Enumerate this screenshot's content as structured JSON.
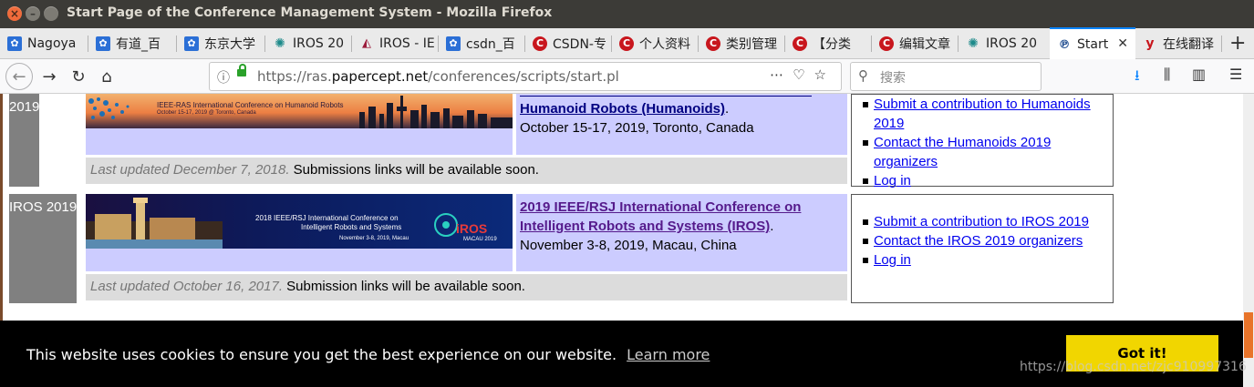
{
  "window": {
    "title": "Start Page of the Conference Management System - Mozilla Firefox"
  },
  "tabs": [
    {
      "label": "Nagoya",
      "icon": "paw-icon"
    },
    {
      "label": "有道_百",
      "icon": "paw-icon"
    },
    {
      "label": "东京大学",
      "icon": "paw-icon"
    },
    {
      "label": "IROS 20",
      "icon": "ieee-icon"
    },
    {
      "label": "IROS - IE",
      "icon": "ieee-icon"
    },
    {
      "label": "csdn_百",
      "icon": "paw-icon"
    },
    {
      "label": "CSDN-专",
      "icon": "csdn-icon"
    },
    {
      "label": "个人资料",
      "icon": "csdn-icon"
    },
    {
      "label": "类别管理",
      "icon": "csdn-icon"
    },
    {
      "label": "【分类",
      "icon": "csdn-icon"
    },
    {
      "label": "编辑文章",
      "icon": "csdn-icon"
    },
    {
      "label": "IROS 20",
      "icon": "ieee-icon"
    },
    {
      "label": "Start",
      "icon": "papercept-icon",
      "active": true
    },
    {
      "label": "在线翻译",
      "icon": "youdao-icon"
    }
  ],
  "nav": {
    "url_prefix": "https://ras.",
    "url_domain": "papercept.net",
    "url_path": "/conferences/scripts/start.pl",
    "search_placeholder": "搜索"
  },
  "conferences": [
    {
      "name": "2019",
      "title": "Humanoid Robots (Humanoids)",
      "title_suffix": ".",
      "dates": "October 15-17, 2019, Toronto, Canada",
      "banner_text": "IEEE-RAS International Conference on Humanoid Robots",
      "banner_sub": "October 15-17, 2019 @ Toronto, Canada",
      "updated_date": "Last updated December 7, 2018.",
      "updated_msg": " Submissions links will be available soon.",
      "links": [
        "Submit a contribution to Humanoids 2019",
        "Contact the Humanoids 2019 organizers",
        "Log in"
      ]
    },
    {
      "name": "IROS 2019",
      "title_line1": "2019 IEEE/RSJ International Conference on",
      "title_line2": "Intelligent Robots and Systems (IROS)",
      "title_suffix": ".",
      "dates": "November 3-8, 2019, Macau, China",
      "banner_text": "2018 IEEE/RSJ International Conference on",
      "banner_text2": "Intelligent Robots and Systems",
      "banner_sub": "November 3-8, 2019, Macau",
      "banner_logo": "iROS",
      "banner_logo_sub": "MACAU 2019",
      "updated_date": "Last updated October 16, 2017.",
      "updated_msg": " Submission links will be available soon.",
      "links": [
        "Submit a contribution to IROS 2019",
        "Contact the IROS 2019 organizers",
        "Log in"
      ]
    }
  ],
  "cookie": {
    "message": "This website uses cookies to ensure you get the best experience on our website.",
    "learn_more": "Learn more",
    "button": "Got it!"
  },
  "watermark": "https://blog.csdn.net/zjc910997316",
  "colors": {
    "accent": "#0a84ff",
    "cookie_button": "#f1d600",
    "row_bg": "#ccccff",
    "name_bg": "#808080"
  }
}
